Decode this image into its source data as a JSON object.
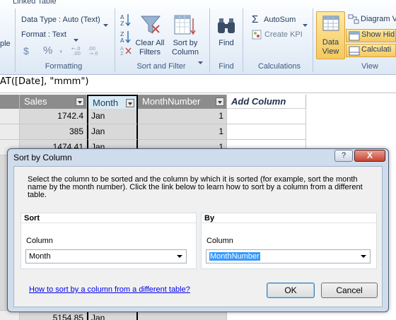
{
  "ribbon": {
    "tab_partial": "Linked Table",
    "left_cut": "ple",
    "data_type": "Data Type : Auto (Text)",
    "format": "Format : Text",
    "format_symbols": {
      "dollar": "$",
      "percent": "%",
      "comma": ","
    },
    "groups": {
      "formatting": "Formatting",
      "sort_filter": "Sort and Filter",
      "find": "Find",
      "calculations": "Calculations",
      "view": "View"
    },
    "buttons": {
      "clear_filters": "Clear All Filters",
      "sort_by_column": "Sort by Column",
      "find": "Find",
      "autosum": "AutoSum",
      "create_kpi": "Create KPI",
      "data_view": "Data View",
      "diagram_view": "Diagram V",
      "show_hidden": "Show Hid",
      "calculation_area": "Calculati"
    }
  },
  "formula_bar": {
    "text": "AT([Date], \"mmm\")"
  },
  "grid": {
    "columns": [
      "Sales",
      "Month",
      "MonthNumber",
      "Add Column"
    ],
    "rows": [
      {
        "sales": "1742.4",
        "month": "Jan",
        "month_number": "1"
      },
      {
        "sales": "385",
        "month": "Jan",
        "month_number": "1"
      },
      {
        "sales": "1474.41",
        "month": "Jan",
        "month_number": "1"
      }
    ],
    "bottom_row": {
      "sales": "5154.85",
      "month": "Jan"
    }
  },
  "dialog": {
    "title": "Sort by Column",
    "help": "?",
    "close": "X",
    "description": "Select the column to be sorted and the column by which it is sorted (for example, sort the month name by the month number). Click the link below to learn how to sort by a column from a different table.",
    "sort": {
      "title": "Sort",
      "label": "Column",
      "value": "Month"
    },
    "by": {
      "title": "By",
      "label": "Column",
      "value": "MonthNumber"
    },
    "link": "How to sort by a column from a different table?",
    "ok": "OK",
    "cancel": "Cancel"
  },
  "colors": {
    "accent": "#3399ff",
    "header_bg": "#8c8c8c",
    "dialog_border": "#4b5c75"
  }
}
